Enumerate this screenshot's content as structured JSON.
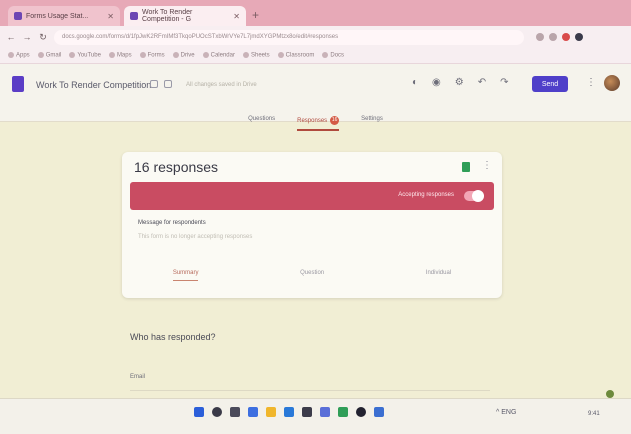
{
  "browser": {
    "tabs": [
      {
        "label": "Forms Usage Stat..."
      },
      {
        "label": "Work To Render Competition - G"
      }
    ],
    "new_tab_icon": "plus-icon",
    "url": "docs.google.com/forms/d/1fpJwK2RFmIMf3TkqoPUOcSTxbWrVYe7L7jmdXYGPMtzx8o/edit#responses",
    "bookmarks": [
      "Apps",
      "Gmail",
      "YouTube",
      "Maps",
      "Forms",
      "Drive",
      "Calendar",
      "Sheets",
      "Classroom",
      "Docs"
    ]
  },
  "forms": {
    "title": "Work To Render Competition",
    "save_status": "All changes saved in Drive",
    "send_label": "Send"
  },
  "tabs": [
    {
      "label": "Questions"
    },
    {
      "label": "Responses",
      "badge": "16"
    },
    {
      "label": "Settings"
    }
  ],
  "responses": {
    "count_label": "16 responses",
    "accepting_label": "Accepting responses",
    "message_label": "Message for respondents",
    "message_placeholder": "This form is no longer accepting responses",
    "view_tabs": [
      "Summary",
      "Question",
      "Individual"
    ]
  },
  "who": {
    "heading": "Who has responded?",
    "email_label": "Email"
  },
  "taskbar": {
    "tray": "^  ENG",
    "clock": "9:41"
  },
  "colors": {
    "accent": "#c94c62",
    "send": "#4f3fc9",
    "forms_logo": "#5b3dc6"
  }
}
